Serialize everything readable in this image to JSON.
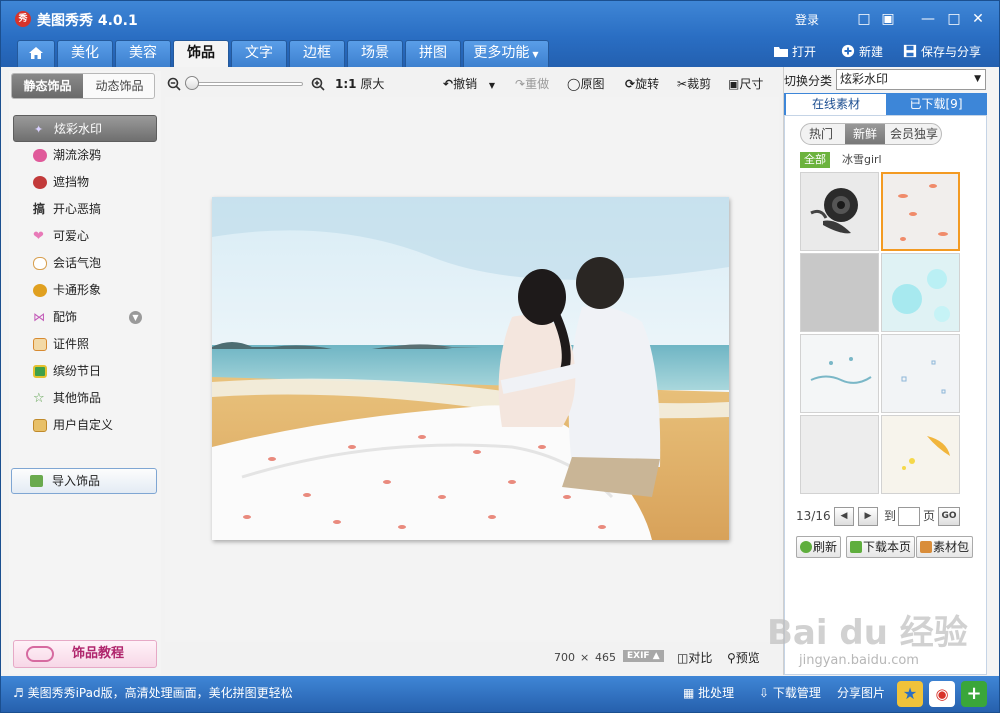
{
  "app": {
    "title": "美图秀秀 4.0.1",
    "logo_text": "秀",
    "login": "登录"
  },
  "nav": {
    "home_icon": "home-icon",
    "tabs": [
      {
        "label": "美化"
      },
      {
        "label": "美容"
      },
      {
        "label": "饰品",
        "active": true
      },
      {
        "label": "文字"
      },
      {
        "label": "边框"
      },
      {
        "label": "场景"
      },
      {
        "label": "拼图"
      },
      {
        "label": "更多功能"
      }
    ],
    "open": "打开",
    "new": "新建",
    "save_share": "保存与分享"
  },
  "left_panel": {
    "tabs": [
      "静态饰品",
      "动态饰品"
    ],
    "categories": [
      {
        "label": "炫彩水印",
        "icon": "sparkle-icon",
        "color": "#8a7fc8",
        "active": true
      },
      {
        "label": "潮流涂鸦",
        "icon": "lips-icon",
        "color": "#e05a9a"
      },
      {
        "label": "遮挡物",
        "icon": "mask-icon",
        "color": "#c23a3a"
      },
      {
        "label": "开心恶搞",
        "icon": "prank-icon",
        "color": "#333333"
      },
      {
        "label": "可爱心",
        "icon": "heart-icon",
        "color": "#e87ab8"
      },
      {
        "label": "会话气泡",
        "icon": "speech-bubble-icon",
        "color": "#d8a050"
      },
      {
        "label": "卡通形象",
        "icon": "cartoon-icon",
        "color": "#e0a020"
      },
      {
        "label": "配饰",
        "icon": "bow-icon",
        "color": "#c35ab8",
        "more": true
      },
      {
        "label": "证件照",
        "icon": "id-photo-icon",
        "color": "#d78a30"
      },
      {
        "label": "缤纷节日",
        "icon": "gift-icon",
        "color": "#3fa04a"
      },
      {
        "label": "其他饰品",
        "icon": "star-icon",
        "color": "#59a04a"
      },
      {
        "label": "用户自定义",
        "icon": "folder-icon",
        "color": "#d9a33a"
      }
    ],
    "import_label": "导入饰品",
    "tutorial_label": "饰品教程"
  },
  "toolbar": {
    "zoom_ratio_label": "1:1",
    "original_size": "原大",
    "undo": "撤销",
    "redo": "重做",
    "original": "原图",
    "rotate": "旋转",
    "crop": "裁剪",
    "size": "尺寸"
  },
  "canvas": {
    "width": "700",
    "times": "×",
    "height": "465",
    "exif": "EXIF",
    "compare": "对比",
    "preview": "预览"
  },
  "right_panel": {
    "switch_label": "切换分类",
    "selected_category": "炫彩水印",
    "tabs": [
      "在线素材",
      "已下载[9]"
    ],
    "filters": [
      "热门",
      "新鲜",
      "会员独享"
    ],
    "active_filter": "新鲜",
    "all_tag": "全部",
    "sub_tag": "冰雪girl",
    "page_label": "13/16",
    "goto_label": "到",
    "page_unit": "页",
    "go": "GO",
    "refresh": "刷新",
    "download_page": "下载本页",
    "material_pack": "素材包"
  },
  "statusbar": {
    "message": "美图秀秀iPad版，高清处理画面，美化拼图更轻松",
    "batch": "批处理",
    "download_manager": "下载管理",
    "share_photo": "分享图片"
  },
  "watermark": {
    "text": "Bai du 经验",
    "url": "jingyan.baidu.com"
  }
}
